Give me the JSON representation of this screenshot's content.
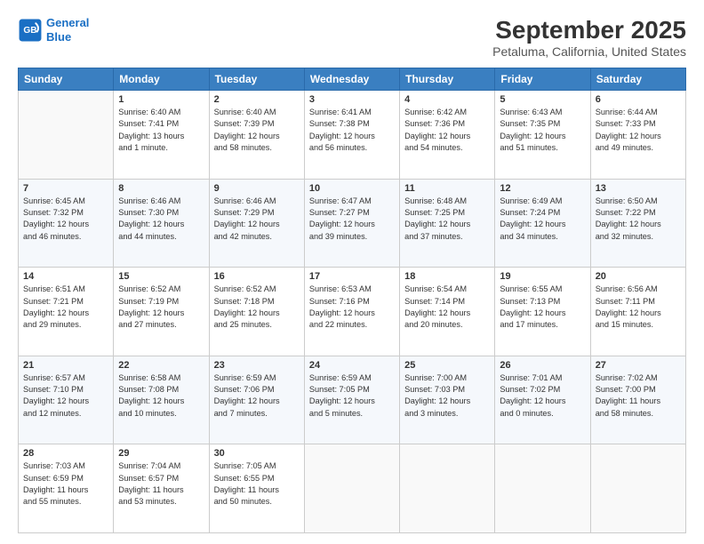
{
  "header": {
    "logo_line1": "General",
    "logo_line2": "Blue",
    "title": "September 2025",
    "subtitle": "Petaluma, California, United States"
  },
  "days_of_week": [
    "Sunday",
    "Monday",
    "Tuesday",
    "Wednesday",
    "Thursday",
    "Friday",
    "Saturday"
  ],
  "weeks": [
    [
      {
        "day": "",
        "info": ""
      },
      {
        "day": "1",
        "info": "Sunrise: 6:40 AM\nSunset: 7:41 PM\nDaylight: 13 hours\nand 1 minute."
      },
      {
        "day": "2",
        "info": "Sunrise: 6:40 AM\nSunset: 7:39 PM\nDaylight: 12 hours\nand 58 minutes."
      },
      {
        "day": "3",
        "info": "Sunrise: 6:41 AM\nSunset: 7:38 PM\nDaylight: 12 hours\nand 56 minutes."
      },
      {
        "day": "4",
        "info": "Sunrise: 6:42 AM\nSunset: 7:36 PM\nDaylight: 12 hours\nand 54 minutes."
      },
      {
        "day": "5",
        "info": "Sunrise: 6:43 AM\nSunset: 7:35 PM\nDaylight: 12 hours\nand 51 minutes."
      },
      {
        "day": "6",
        "info": "Sunrise: 6:44 AM\nSunset: 7:33 PM\nDaylight: 12 hours\nand 49 minutes."
      }
    ],
    [
      {
        "day": "7",
        "info": "Sunrise: 6:45 AM\nSunset: 7:32 PM\nDaylight: 12 hours\nand 46 minutes."
      },
      {
        "day": "8",
        "info": "Sunrise: 6:46 AM\nSunset: 7:30 PM\nDaylight: 12 hours\nand 44 minutes."
      },
      {
        "day": "9",
        "info": "Sunrise: 6:46 AM\nSunset: 7:29 PM\nDaylight: 12 hours\nand 42 minutes."
      },
      {
        "day": "10",
        "info": "Sunrise: 6:47 AM\nSunset: 7:27 PM\nDaylight: 12 hours\nand 39 minutes."
      },
      {
        "day": "11",
        "info": "Sunrise: 6:48 AM\nSunset: 7:25 PM\nDaylight: 12 hours\nand 37 minutes."
      },
      {
        "day": "12",
        "info": "Sunrise: 6:49 AM\nSunset: 7:24 PM\nDaylight: 12 hours\nand 34 minutes."
      },
      {
        "day": "13",
        "info": "Sunrise: 6:50 AM\nSunset: 7:22 PM\nDaylight: 12 hours\nand 32 minutes."
      }
    ],
    [
      {
        "day": "14",
        "info": "Sunrise: 6:51 AM\nSunset: 7:21 PM\nDaylight: 12 hours\nand 29 minutes."
      },
      {
        "day": "15",
        "info": "Sunrise: 6:52 AM\nSunset: 7:19 PM\nDaylight: 12 hours\nand 27 minutes."
      },
      {
        "day": "16",
        "info": "Sunrise: 6:52 AM\nSunset: 7:18 PM\nDaylight: 12 hours\nand 25 minutes."
      },
      {
        "day": "17",
        "info": "Sunrise: 6:53 AM\nSunset: 7:16 PM\nDaylight: 12 hours\nand 22 minutes."
      },
      {
        "day": "18",
        "info": "Sunrise: 6:54 AM\nSunset: 7:14 PM\nDaylight: 12 hours\nand 20 minutes."
      },
      {
        "day": "19",
        "info": "Sunrise: 6:55 AM\nSunset: 7:13 PM\nDaylight: 12 hours\nand 17 minutes."
      },
      {
        "day": "20",
        "info": "Sunrise: 6:56 AM\nSunset: 7:11 PM\nDaylight: 12 hours\nand 15 minutes."
      }
    ],
    [
      {
        "day": "21",
        "info": "Sunrise: 6:57 AM\nSunset: 7:10 PM\nDaylight: 12 hours\nand 12 minutes."
      },
      {
        "day": "22",
        "info": "Sunrise: 6:58 AM\nSunset: 7:08 PM\nDaylight: 12 hours\nand 10 minutes."
      },
      {
        "day": "23",
        "info": "Sunrise: 6:59 AM\nSunset: 7:06 PM\nDaylight: 12 hours\nand 7 minutes."
      },
      {
        "day": "24",
        "info": "Sunrise: 6:59 AM\nSunset: 7:05 PM\nDaylight: 12 hours\nand 5 minutes."
      },
      {
        "day": "25",
        "info": "Sunrise: 7:00 AM\nSunset: 7:03 PM\nDaylight: 12 hours\nand 3 minutes."
      },
      {
        "day": "26",
        "info": "Sunrise: 7:01 AM\nSunset: 7:02 PM\nDaylight: 12 hours\nand 0 minutes."
      },
      {
        "day": "27",
        "info": "Sunrise: 7:02 AM\nSunset: 7:00 PM\nDaylight: 11 hours\nand 58 minutes."
      }
    ],
    [
      {
        "day": "28",
        "info": "Sunrise: 7:03 AM\nSunset: 6:59 PM\nDaylight: 11 hours\nand 55 minutes."
      },
      {
        "day": "29",
        "info": "Sunrise: 7:04 AM\nSunset: 6:57 PM\nDaylight: 11 hours\nand 53 minutes."
      },
      {
        "day": "30",
        "info": "Sunrise: 7:05 AM\nSunset: 6:55 PM\nDaylight: 11 hours\nand 50 minutes."
      },
      {
        "day": "",
        "info": ""
      },
      {
        "day": "",
        "info": ""
      },
      {
        "day": "",
        "info": ""
      },
      {
        "day": "",
        "info": ""
      }
    ]
  ]
}
